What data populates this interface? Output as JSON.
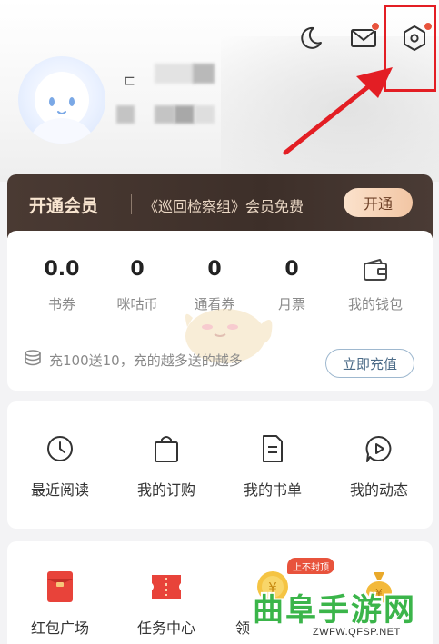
{
  "header": {
    "name_glyph": "ㄷ"
  },
  "vip": {
    "title": "开通会员",
    "description": "《巡回检察组》会员免费",
    "button_label": "开通"
  },
  "stats": [
    {
      "value": "0.0",
      "label": "书券"
    },
    {
      "value": "0",
      "label": "咪咕币"
    },
    {
      "value": "0",
      "label": "通看券"
    },
    {
      "value": "0",
      "label": "月票"
    },
    {
      "value": "",
      "label": "我的钱包"
    }
  ],
  "promo": {
    "text": "充100送10，充的越多送的越多",
    "button_label": "立即充值"
  },
  "quick_links": [
    {
      "label": "最近阅读",
      "icon": "clock-icon"
    },
    {
      "label": "我的订购",
      "icon": "shopping-bag-icon"
    },
    {
      "label": "我的书单",
      "icon": "document-icon"
    },
    {
      "label": "我的动态",
      "icon": "play-chat-icon"
    }
  ],
  "bottom_links": [
    {
      "label": "红包广场",
      "icon": "red-envelope-icon"
    },
    {
      "label": "任务中心",
      "icon": "ticket-icon"
    },
    {
      "label": "领",
      "icon": "coin-icon"
    },
    {
      "label": "",
      "icon": "money-bag-icon"
    }
  ],
  "badge": {
    "text": "上不封顶"
  },
  "watermark": {
    "title": "曲阜手游网",
    "url": "ZWFW.QFSP.NET"
  },
  "colors": {
    "accent_red": "#e31e24",
    "notification_dot": "#e8533c",
    "vip_background": "#3d2f29",
    "vip_button": "#f2c6a4",
    "watermark_green": "#3bb54a"
  }
}
